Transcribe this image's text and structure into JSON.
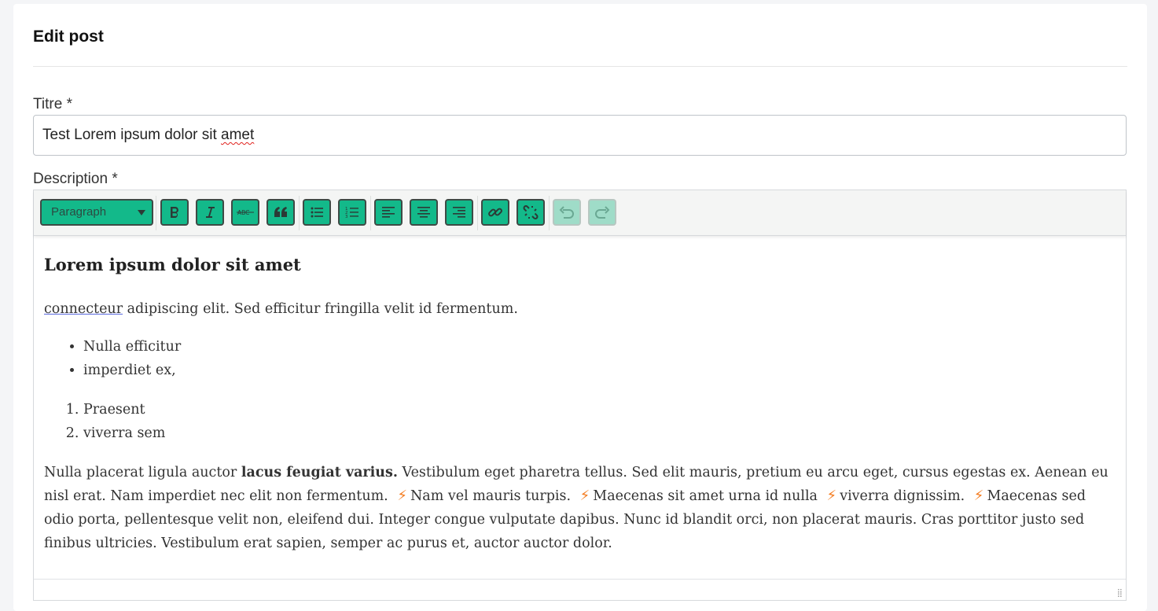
{
  "card": {
    "title": "Edit post"
  },
  "form": {
    "title_label": "Titre *",
    "title_value_plain": "Test Lorem ipsum dolor sit ",
    "title_value_flagged": "amet",
    "description_label": "Description *"
  },
  "toolbar": {
    "format_select": "Paragraph",
    "buttons": [
      "bold-icon",
      "italic-icon",
      "strikethrough-icon",
      "blockquote-icon",
      "bullet-list-icon",
      "numbered-list-icon",
      "align-left-icon",
      "align-center-icon",
      "align-right-icon",
      "link-icon",
      "unlink-icon",
      "undo-icon",
      "redo-icon"
    ],
    "accent_color": "#13b98a"
  },
  "content": {
    "heading": "Lorem ipsum dolor sit amet",
    "para1": {
      "link": "connecteur",
      "rest": " adipiscing elit. Sed efficitur fringilla velit id fermentum."
    },
    "bullets": [
      "Nulla efficitur",
      "imperdiet ex,"
    ],
    "numbered": [
      "Praesent",
      "viverra sem"
    ],
    "para2": {
      "a": "Nulla placerat ligula auctor ",
      "bold": "lacus feugiat varius.",
      "b": " Vestibulum eget pharetra tellus. Sed elit mauris, pretium eu arcu eget, cursus egestas ex. Aenean eu nisl erat. Nam imperdiet nec elit non fermentum. ",
      "c": "Nam vel mauris turpis. ",
      "d": "Maecenas sit amet urna id nulla ",
      "e": "viverra dignissim. ",
      "f": "Maecenas sed odio porta, pellentesque velit non, eleifend dui. Integer congue vulputate dapibus. Nunc id blandit orci, non placerat mauris. Cras porttitor justo sed finibus ultricies. Vestibulum erat sapien, semper ac purus et, auctor auctor dolor."
    },
    "bolt_icon": "lightning-bolt-icon",
    "bolt_color": "#f47c20"
  }
}
